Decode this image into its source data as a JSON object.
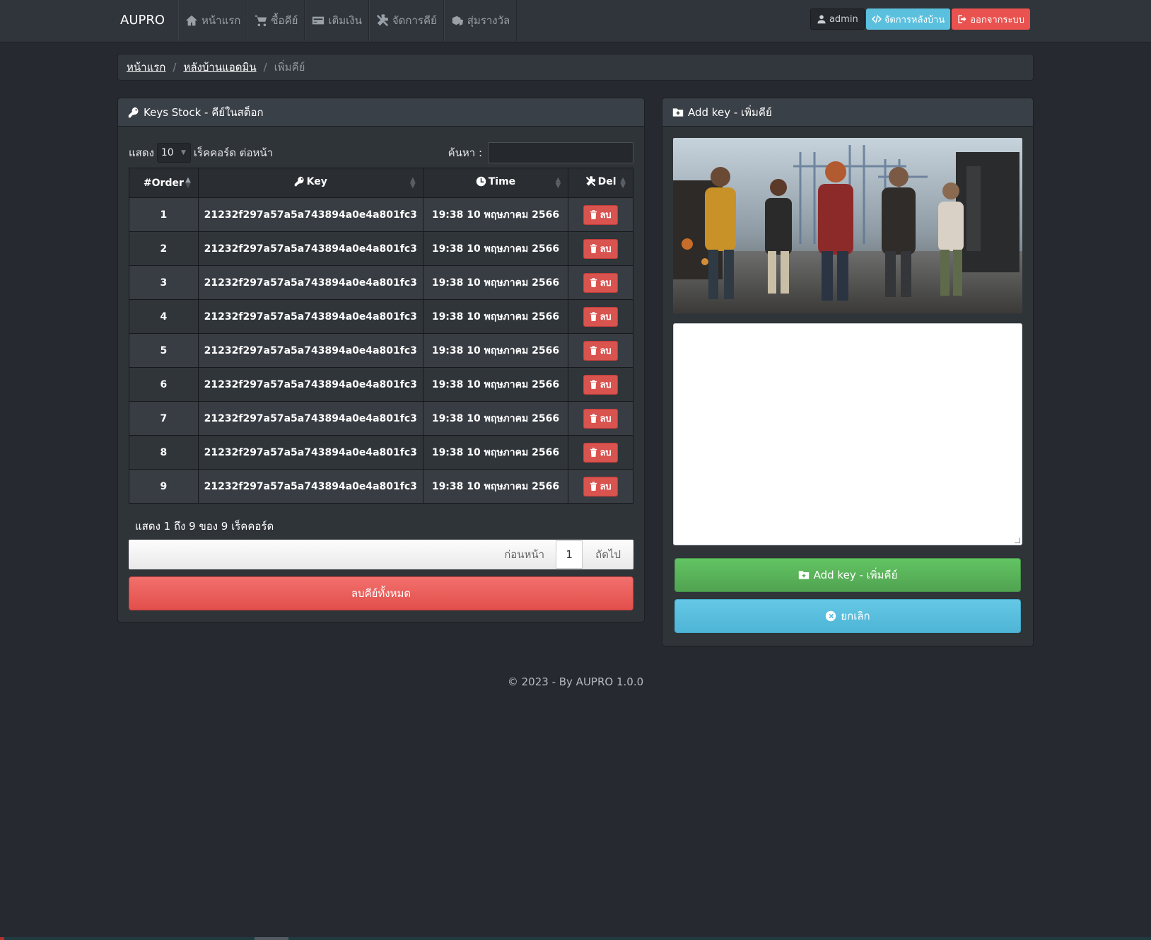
{
  "navbar": {
    "brand": "AUPRO",
    "links": [
      {
        "label": "หน้าแรก",
        "icon": "home-icon"
      },
      {
        "label": "ซื้อคีย์",
        "icon": "cart-icon"
      },
      {
        "label": "เติมเงิน",
        "icon": "credit-card-icon"
      },
      {
        "label": "จัดการคีย์",
        "icon": "tools-icon"
      },
      {
        "label": "สุ่มรางวัล",
        "icon": "dice-icon"
      }
    ],
    "user": "admin",
    "admin_button": "จัดการหลังบ้าน",
    "logout_button": "ออกจากระบบ"
  },
  "breadcrumb": {
    "home": "หน้าแรก",
    "admin": "หลังบ้านแอดมิน",
    "current": "เพิ่มคีย์"
  },
  "stock_panel": {
    "title": "Keys Stock - คีย์ในสต็อก",
    "show_label": "แสดง",
    "page_size": "10",
    "per_page_label": "เร็คคอร์ด ต่อหน้า",
    "search_label": "ค้นหา :",
    "columns": {
      "order": "#Order",
      "key": "Key",
      "time": "Time",
      "del": "Del"
    },
    "delete_label": "ลบ",
    "rows": [
      {
        "order": "1",
        "key": "21232f297a57a5a743894a0e4a801fc3",
        "time": "19:38 10 พฤษภาคม 2566"
      },
      {
        "order": "2",
        "key": "21232f297a57a5a743894a0e4a801fc3",
        "time": "19:38 10 พฤษภาคม 2566"
      },
      {
        "order": "3",
        "key": "21232f297a57a5a743894a0e4a801fc3",
        "time": "19:38 10 พฤษภาคม 2566"
      },
      {
        "order": "4",
        "key": "21232f297a57a5a743894a0e4a801fc3",
        "time": "19:38 10 พฤษภาคม 2566"
      },
      {
        "order": "5",
        "key": "21232f297a57a5a743894a0e4a801fc3",
        "time": "19:38 10 พฤษภาคม 2566"
      },
      {
        "order": "6",
        "key": "21232f297a57a5a743894a0e4a801fc3",
        "time": "19:38 10 พฤษภาคม 2566"
      },
      {
        "order": "7",
        "key": "21232f297a57a5a743894a0e4a801fc3",
        "time": "19:38 10 พฤษภาคม 2566"
      },
      {
        "order": "8",
        "key": "21232f297a57a5a743894a0e4a801fc3",
        "time": "19:38 10 พฤษภาคม 2566"
      },
      {
        "order": "9",
        "key": "21232f297a57a5a743894a0e4a801fc3",
        "time": "19:38 10 พฤษภาคม 2566"
      }
    ],
    "info": "แสดง 1 ถึง 9 ของ 9 เร็คคอร์ด",
    "pager": {
      "prev": "ก่อนหน้า",
      "page": "1",
      "next": "ถัดไป"
    },
    "delete_all": "ลบคีย์ทั้งหมด"
  },
  "add_panel": {
    "title": "Add key - เพิ่มคีย์",
    "textarea_value": "",
    "add_button": "Add key - เพิ่มคีย์",
    "cancel_button": "ยกเลิก"
  },
  "footer": "© 2023 - By AUPRO 1.0.0",
  "colors": {
    "background": "#262a30",
    "navbar": "#30353b",
    "info": "#5bc0de",
    "danger": "#d9534f",
    "success": "#5cb85c"
  }
}
